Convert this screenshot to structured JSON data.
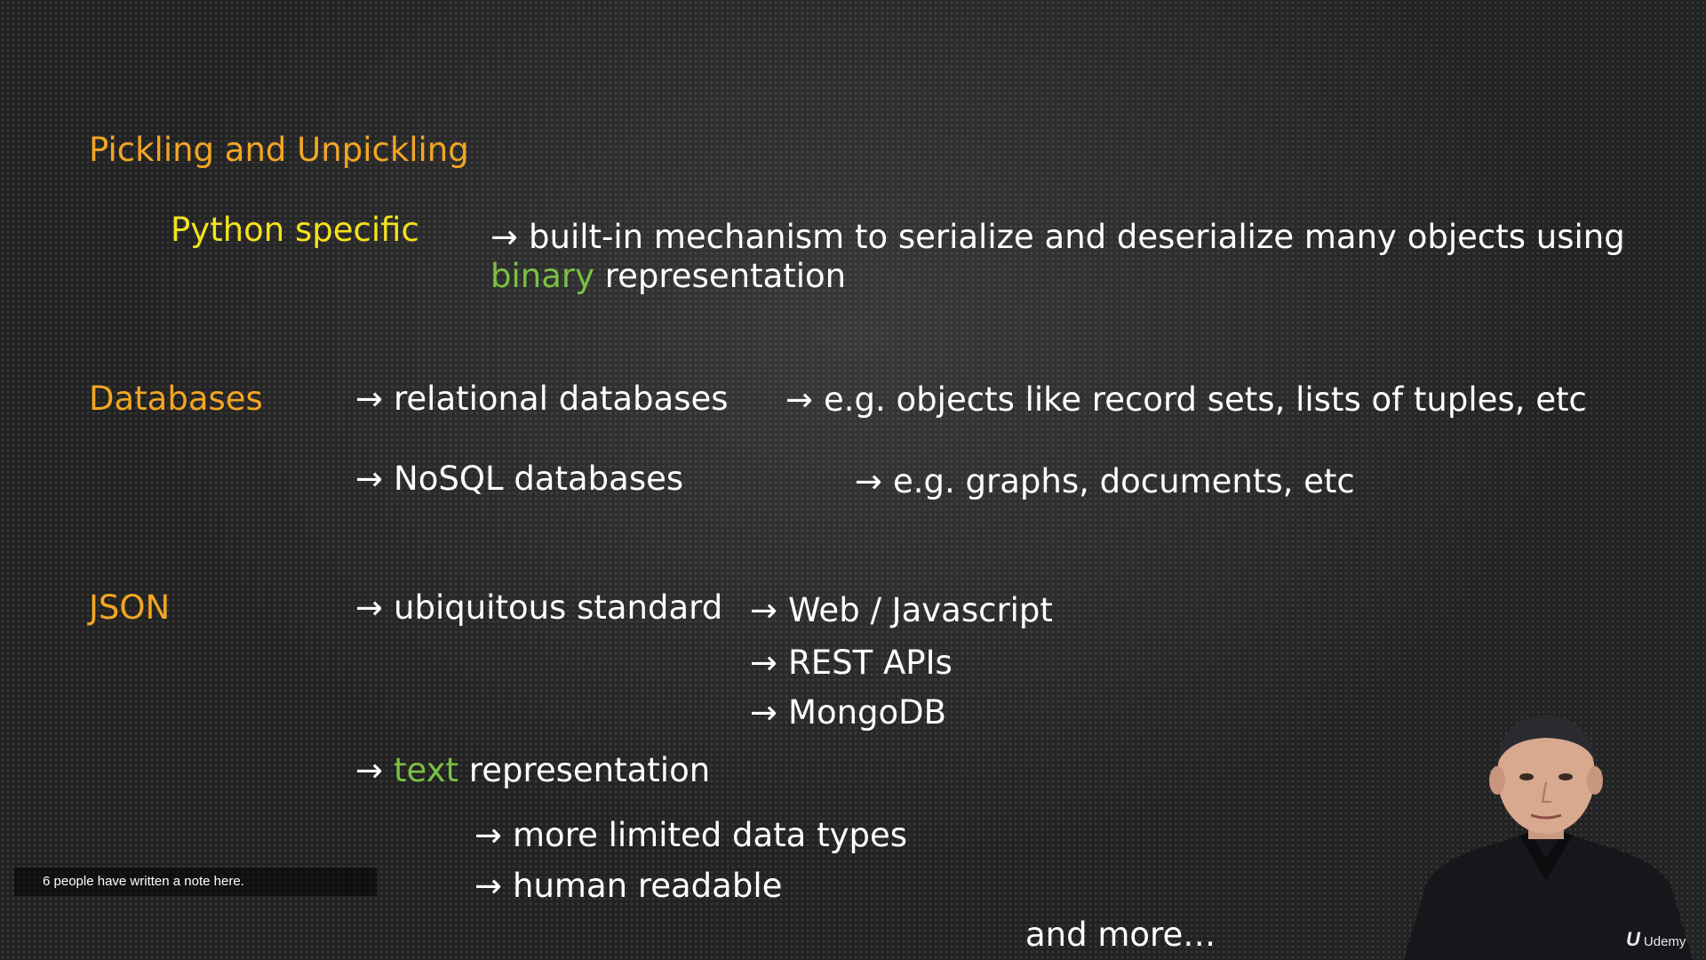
{
  "slide": {
    "pickling": {
      "heading": "Pickling and Unpickling",
      "subhead": "Python specific",
      "line1": "built-in mechanism to serialize and deserialize many objects using",
      "line2_highlight": "binary",
      "line2_rest": " representation"
    },
    "databases": {
      "heading": "Databases",
      "relational": "relational databases",
      "relational_example": "e.g. objects like record sets, lists of tuples, etc",
      "nosql": "NoSQL databases",
      "nosql_example": "e.g. graphs, documents, etc"
    },
    "json": {
      "heading": "JSON",
      "standard": "ubiquitous standard",
      "uses": [
        "Web / Javascript",
        "REST APIs",
        "MongoDB"
      ],
      "text_highlight": "text",
      "text_rest": " representation",
      "limited": "more limited data types",
      "readable": "human readable"
    },
    "more": "and more…",
    "arrow_glyph": "→"
  },
  "overlay": {
    "note_text": "6 people have written a note here.",
    "watermark": "Udemy",
    "watermark_logo": "U"
  },
  "colors": {
    "heading": "#f2a623",
    "subhead": "#f4e21c",
    "highlight": "#7bc043",
    "text": "#ffffff"
  }
}
